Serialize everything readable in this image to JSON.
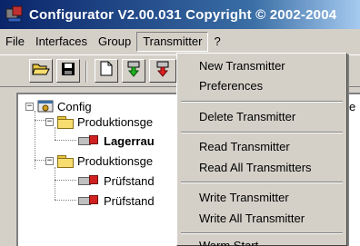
{
  "window": {
    "title": "Configurator  V2.00.031 Copyright © 2002-2004"
  },
  "menubar": {
    "items": [
      "File",
      "Interfaces",
      "Group",
      "Transmitter",
      "?"
    ]
  },
  "toolbar": {
    "buttons": [
      "open-folder-icon",
      "save-disk-icon",
      "new-document-icon",
      "read-green-arrow-icon",
      "write-red-arrow-icon"
    ]
  },
  "tree": {
    "root": "Config",
    "groups": [
      {
        "label": "Produktionsge",
        "children": [
          "Lagerrau"
        ]
      },
      {
        "label": "Produktionsge",
        "children": [
          "Prüfstand",
          "Prüfstand"
        ]
      }
    ],
    "right_edge_text": "e"
  },
  "dropdown": {
    "items": [
      "New Transmitter",
      "Preferences",
      "Delete Transmitter",
      "Read Transmitter",
      "Read All Transmitters",
      "Write Transmitter",
      "Write All Transmitter",
      "Warm Start"
    ]
  },
  "colors": {
    "titlebar_start": "#0a246a",
    "titlebar_end": "#a6caf0",
    "face": "#d4d0c8"
  }
}
